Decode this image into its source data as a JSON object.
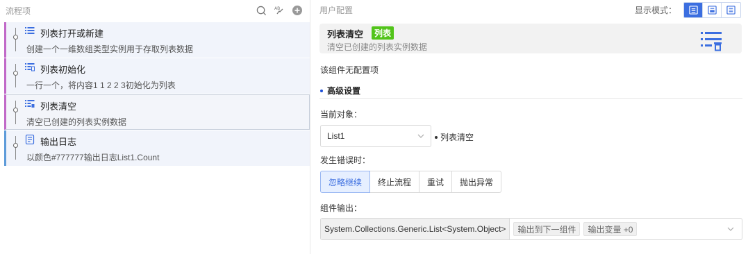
{
  "left_panel": {
    "title": "流程项",
    "items": [
      {
        "title": "列表打开或新建",
        "desc": "创建一个一维数组类型实例用于存取列表数据",
        "icon": "list-icon"
      },
      {
        "title": "列表初始化",
        "desc": "一行一个，将内容1 1 2 2 3初始化为列表",
        "icon": "list-init-icon"
      },
      {
        "title": "列表清空",
        "desc": "清空已创建的列表实例数据",
        "icon": "list-clear-icon"
      },
      {
        "title": "输出日志",
        "desc": "以颜色#777777输出日志List1.Count",
        "icon": "log-icon"
      }
    ]
  },
  "right_panel": {
    "title": "用户配置",
    "display_mode_label": "显示模式：",
    "component": {
      "title": "列表清空",
      "tag": "列表",
      "desc": "清空已创建的列表实例数据"
    },
    "no_config": "该组件无配置项",
    "advanced_title": "高级设置",
    "current_object_label": "当前对象：",
    "current_object_value": "List1",
    "current_object_note": "列表清空",
    "on_error_label": "发生错误时：",
    "on_error_options": [
      "忽略继续",
      "终止流程",
      "重试",
      "抛出异常"
    ],
    "output_label": "组件输出：",
    "output_type": "System.Collections.Generic.List<System.Object>",
    "output_tags": [
      "输出到下一组件",
      "输出变量 +0"
    ]
  },
  "colors": {
    "accent": "#3b6ee0",
    "flow_bar": "#c169c8",
    "log_bar": "#5d9bd9",
    "tag_green": "#52c41a"
  }
}
